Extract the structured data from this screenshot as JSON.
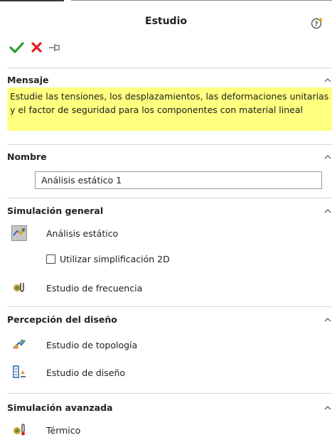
{
  "header": {
    "title": "Estudio"
  },
  "icons": {
    "help": "help-question-icon",
    "ok": "checkmark-icon",
    "cancel": "close-x-icon",
    "pin": "pushpin-icon",
    "collapse": "chevron-up-icon"
  },
  "colors": {
    "ok_green": "#2e9e2e",
    "cancel_red": "#e02020",
    "message_bg": "#ffff80"
  },
  "message": {
    "header": "Mensaje",
    "text": "Estudie las tensiones, los desplazamientos, las deformaciones unitarias y el factor de seguridad para los componentes con material lineal"
  },
  "name_section": {
    "header": "Nombre",
    "value": "Análisis estático 1"
  },
  "general": {
    "header": "Simulación general",
    "static_label": "Análisis estático",
    "checkbox_label": "Utilizar simplificación 2D",
    "checkbox_checked": false,
    "frequency_label": "Estudio de frecuencia"
  },
  "design": {
    "header": "Percepción del diseño",
    "topology_label": "Estudio de topología",
    "design_label": "Estudio de diseño"
  },
  "advanced": {
    "header": "Simulación avanzada",
    "thermal_label": "Térmico"
  }
}
